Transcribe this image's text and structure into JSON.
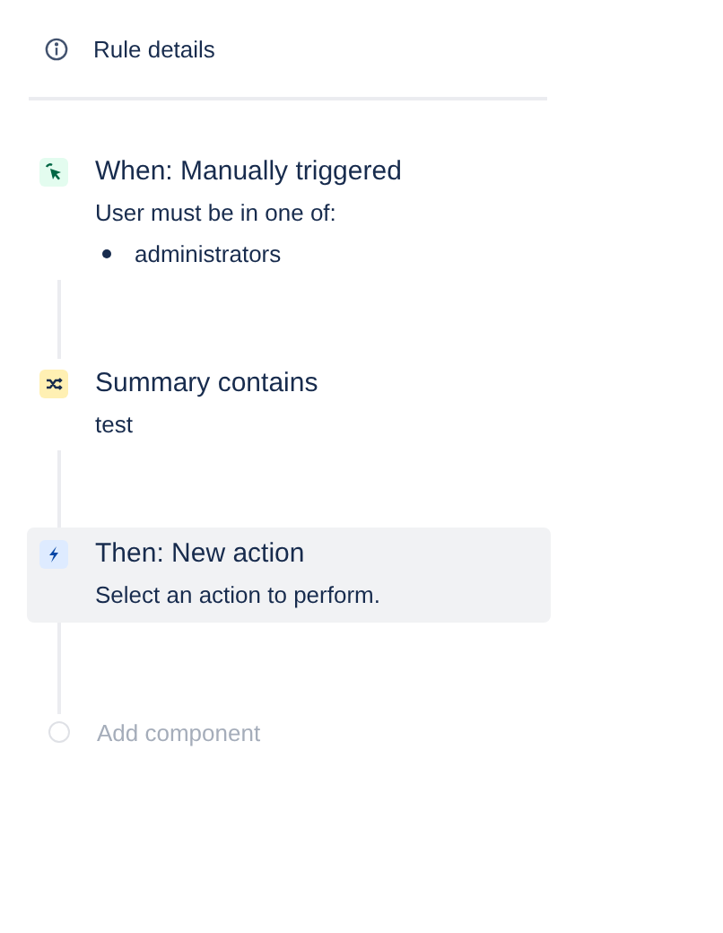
{
  "header": {
    "label": "Rule details"
  },
  "steps": [
    {
      "kind": "trigger",
      "title": "When: Manually triggered",
      "description": "User must be in one of:",
      "items": [
        "administrators"
      ],
      "selected": false
    },
    {
      "kind": "condition",
      "title": "Summary contains",
      "description": "test",
      "selected": false
    },
    {
      "kind": "action",
      "title": "Then: New action",
      "description": "Select an action to perform.",
      "selected": true
    }
  ],
  "add_component": {
    "label": "Add component"
  }
}
